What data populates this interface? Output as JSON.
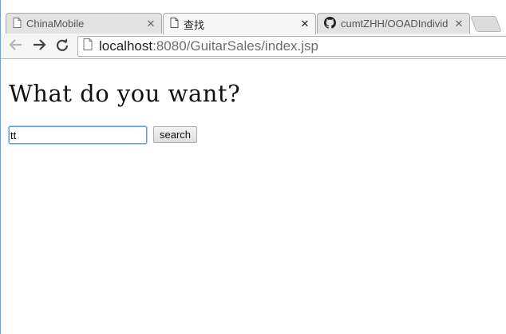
{
  "browser": {
    "tabs": [
      {
        "label": "ChinaMobile",
        "icon": "page-icon",
        "active": false
      },
      {
        "label": "查找",
        "icon": "page-icon",
        "active": true
      },
      {
        "label": "cumtZHH/OOADIndivid",
        "icon": "github-icon",
        "active": false
      }
    ],
    "address": {
      "host": "localhost",
      "rest": ":8080/GuitarSales/index.jsp"
    }
  },
  "page": {
    "heading": "What do you want?",
    "search": {
      "value": "tt",
      "button_label": "search"
    }
  },
  "colors": {
    "window_border": "#6fa0e0",
    "input_focus": "#5b9ee6"
  }
}
